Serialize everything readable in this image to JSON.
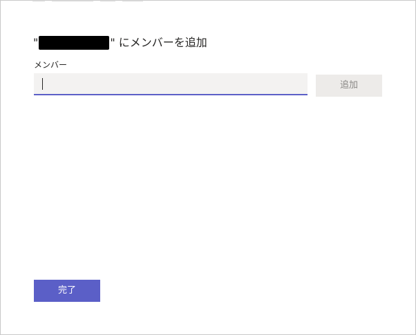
{
  "dialog": {
    "title_prefix": "\"",
    "title_suffix": "\" にメンバーを追加"
  },
  "member_field": {
    "label": "メンバー",
    "value": "",
    "placeholder": ""
  },
  "buttons": {
    "add_label": "追加",
    "done_label": "完了"
  },
  "colors": {
    "accent": "#5b5fc7",
    "input_background": "#f3f2f1",
    "disabled_button_background": "#edebe9",
    "disabled_button_text": "#8a8886"
  }
}
